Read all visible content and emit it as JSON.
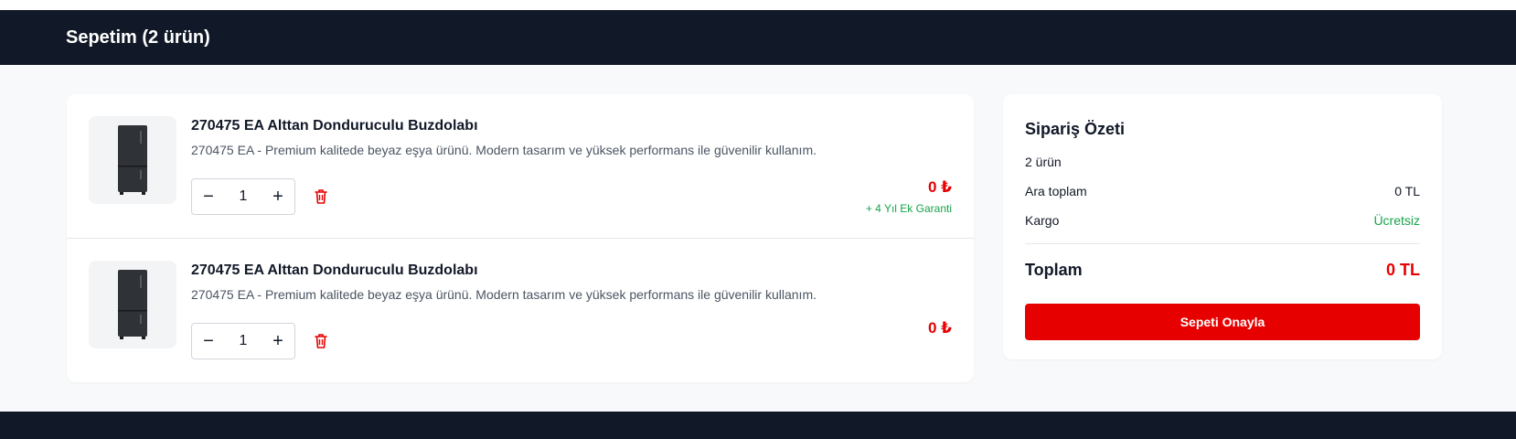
{
  "header": {
    "title": "Sepetim (2 ürün)"
  },
  "cart": {
    "items": [
      {
        "title": "270475 EA Alttan Donduruculu Buzdolabı",
        "description": "270475 EA - Premium kalitede beyaz eşya ürünü. Modern tasarım ve yüksek performans ile güvenilir kullanım.",
        "quantity": "1",
        "minus": "−",
        "plus": "+",
        "price": "0 ₺",
        "warranty": "+ 4 Yıl Ek Garanti"
      },
      {
        "title": "270475 EA Alttan Donduruculu Buzdolabı",
        "description": "270475 EA - Premium kalitede beyaz eşya ürünü. Modern tasarım ve yüksek performans ile güvenilir kullanım.",
        "quantity": "1",
        "minus": "−",
        "plus": "+",
        "price": "0 ₺"
      }
    ]
  },
  "summary": {
    "title": "Sipariş Özeti",
    "item_count": "2 ürün",
    "subtotal_label": "Ara toplam",
    "subtotal_value": "0 TL",
    "shipping_label": "Kargo",
    "shipping_value": "Ücretsiz",
    "total_label": "Toplam",
    "total_value": "0 TL",
    "confirm_label": "Sepeti Onayla"
  },
  "colors": {
    "header_bg": "#111827",
    "accent_red": "#e60000",
    "success_green": "#16a34a",
    "page_bg": "#f8f9fa"
  },
  "icons": [
    "fridge-image",
    "minus-icon",
    "plus-icon",
    "trash-icon"
  ]
}
